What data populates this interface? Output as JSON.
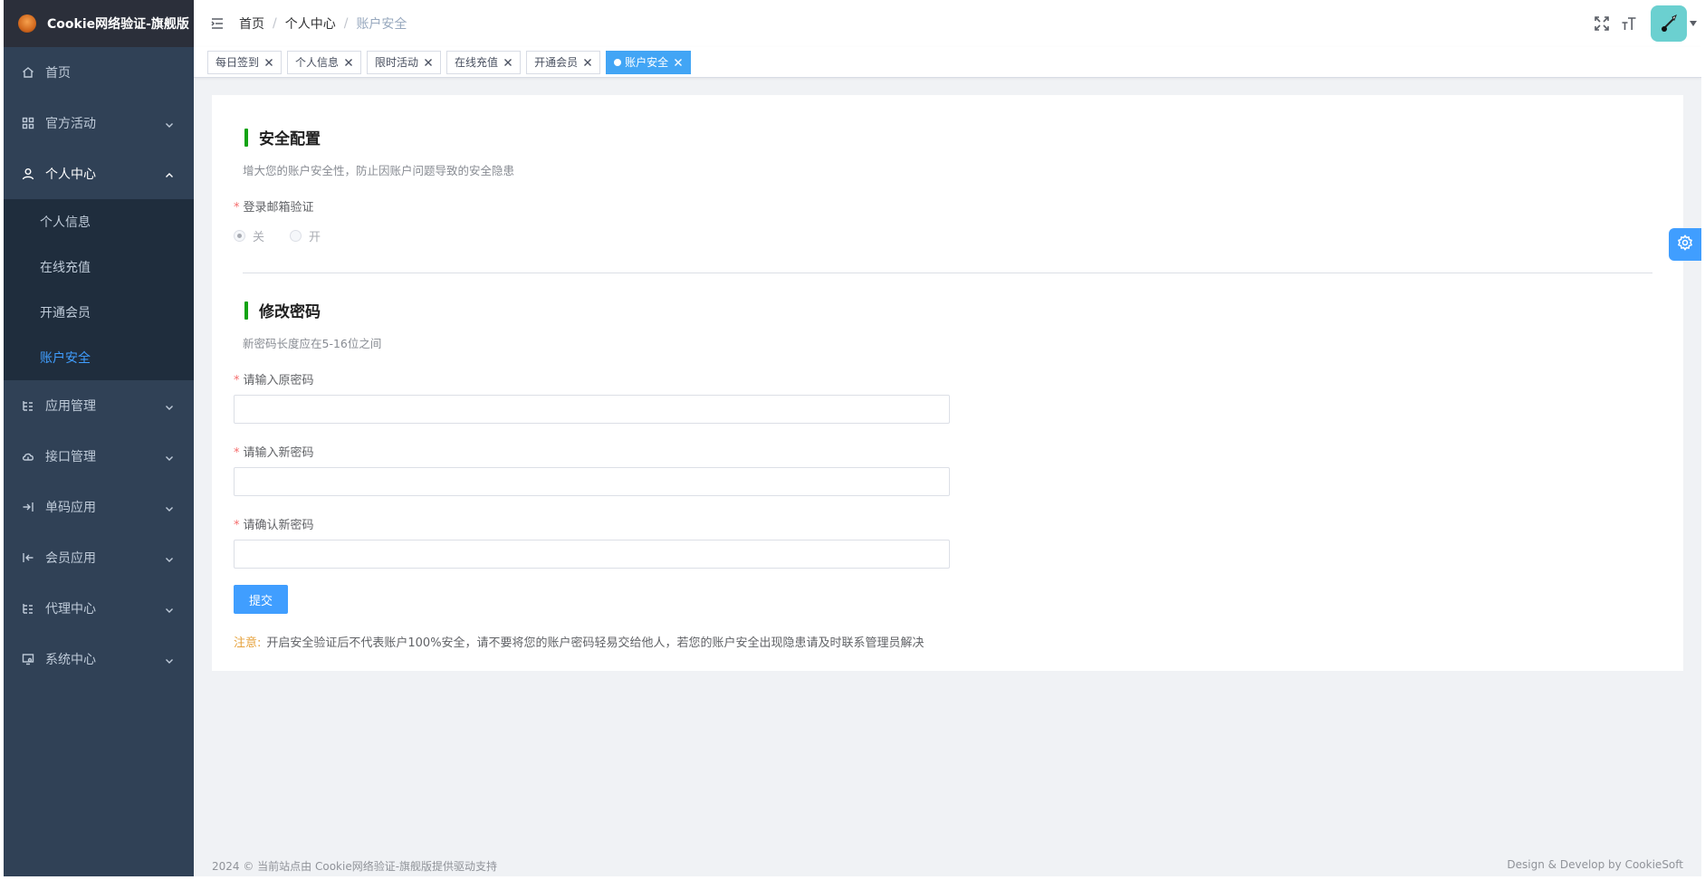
{
  "app": {
    "title": "Cookie网络验证-旗舰版"
  },
  "sidebar": {
    "menu": [
      {
        "label": "首页",
        "icon": "home-icon"
      },
      {
        "label": "官方活动",
        "icon": "grid-icon"
      },
      {
        "label": "个人中心",
        "icon": "user-icon",
        "open": true,
        "children": [
          {
            "label": "个人信息"
          },
          {
            "label": "在线充值"
          },
          {
            "label": "开通会员"
          },
          {
            "label": "账户安全",
            "active": true
          }
        ]
      },
      {
        "label": "应用管理",
        "icon": "tree-icon"
      },
      {
        "label": "接口管理",
        "icon": "cloud-icon"
      },
      {
        "label": "单码应用",
        "icon": "login-icon"
      },
      {
        "label": "会员应用",
        "icon": "logout-icon"
      },
      {
        "label": "代理中心",
        "icon": "tree-icon"
      },
      {
        "label": "系统中心",
        "icon": "monitor-icon"
      }
    ]
  },
  "navbar": {
    "breadcrumb": [
      "首页",
      "个人中心",
      "账户安全"
    ]
  },
  "tags": [
    {
      "label": "每日签到"
    },
    {
      "label": "个人信息"
    },
    {
      "label": "限时活动"
    },
    {
      "label": "在线充值"
    },
    {
      "label": "开通会员"
    },
    {
      "label": "账户安全",
      "active": true
    }
  ],
  "security": {
    "title": "安全配置",
    "description": "增大您的账户安全性，防止因账户问题导致的安全隐患",
    "email_verify_label": "登录邮箱验证",
    "options": [
      "关",
      "开"
    ],
    "selected": "关"
  },
  "password": {
    "title": "修改密码",
    "description": "新密码长度应在5-16位之间",
    "old_label": "请输入原密码",
    "new_label": "请输入新密码",
    "confirm_label": "请确认新密码",
    "old_value": "",
    "new_value": "",
    "confirm_value": "",
    "submit_label": "提交"
  },
  "notice": {
    "label": "注意:",
    "text": "开启安全验证后不代表账户100%安全，请不要将您的账户密码轻易交给他人，若您的账户安全出现隐患请及时联系管理员解决"
  },
  "footer": {
    "left": "2024 © 当前站点由 Cookie网络验证-旗舰版提供驱动支持",
    "right": "Design & Develop by CookieSoft"
  },
  "colors": {
    "sidebar_bg": "#304156",
    "submenu_bg": "#1f2d3d",
    "accent": "#409eff",
    "section_bar": "#13a313",
    "notice": "#e6a23c",
    "required": "#f56c6c"
  }
}
